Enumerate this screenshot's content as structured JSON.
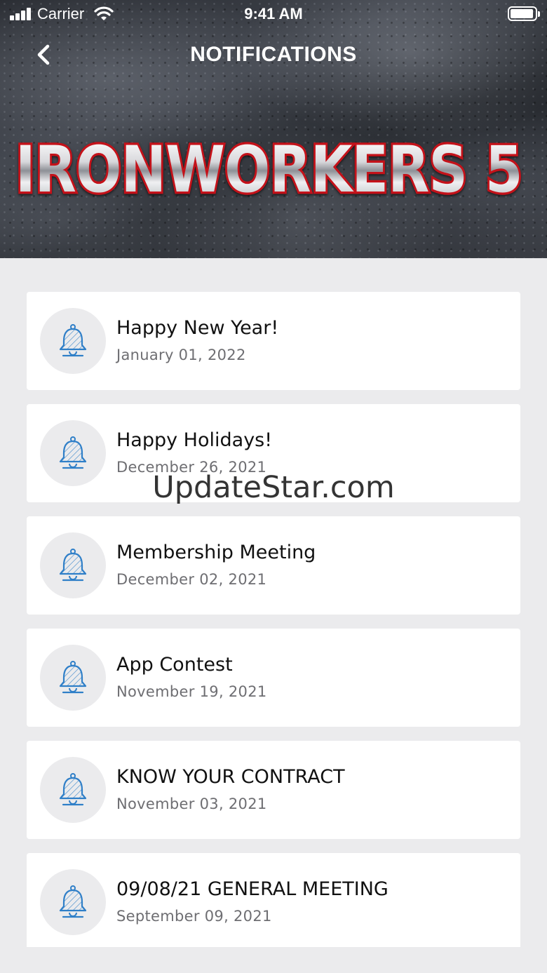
{
  "status_bar": {
    "carrier": "Carrier",
    "time": "9:41 AM"
  },
  "nav": {
    "title": "NOTIFICATIONS"
  },
  "banner": {
    "logo_text": "IRONWORKERS 5"
  },
  "notifications": [
    {
      "title": "Happy New Year!",
      "date": "January 01, 2022"
    },
    {
      "title": "Happy Holidays!",
      "date": "December 26, 2021"
    },
    {
      "title": "Membership Meeting",
      "date": "December 02, 2021"
    },
    {
      "title": "App Contest",
      "date": "November 19, 2021"
    },
    {
      "title": "KNOW YOUR CONTRACT",
      "date": "November 03, 2021"
    },
    {
      "title": "09/08/21 GENERAL MEETING",
      "date": "September 09, 2021"
    }
  ],
  "watermark": "UpdateStar.com",
  "colors": {
    "background": "#ebebed",
    "card": "#ffffff",
    "icon_accent": "#2f7fc8",
    "logo_outline": "#c4121a"
  }
}
